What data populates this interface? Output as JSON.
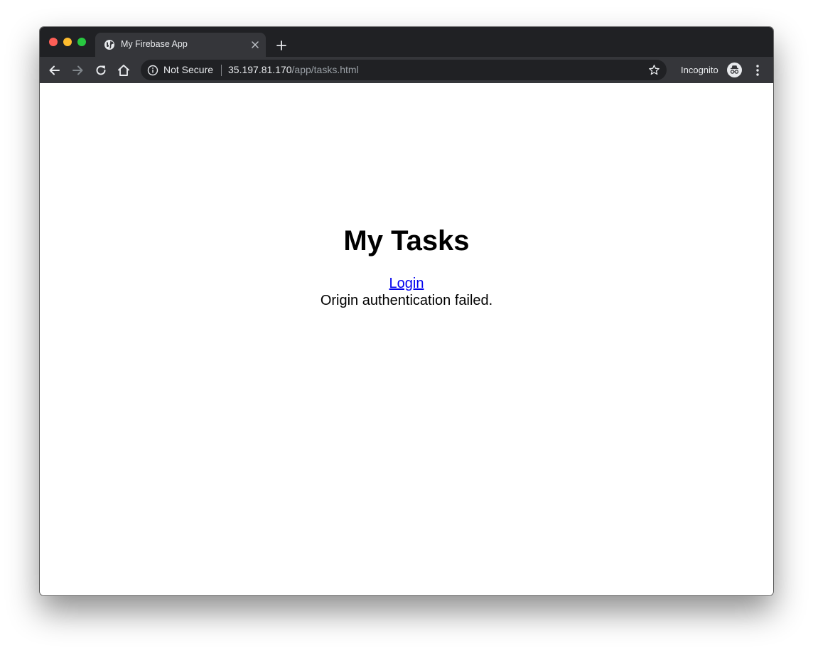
{
  "browser": {
    "tab": {
      "title": "My Firebase App",
      "favicon": "globe-icon"
    },
    "toolbar": {
      "security_label": "Not Secure",
      "url_host": "35.197.81.170",
      "url_path": "/app/tasks.html",
      "profile_label": "Incognito"
    }
  },
  "page": {
    "title": "My Tasks",
    "login_link": "Login",
    "status_message": "Origin authentication failed."
  },
  "colors": {
    "titlebar": "#202124",
    "toolbar": "#35363a",
    "link": "#0000ee"
  }
}
